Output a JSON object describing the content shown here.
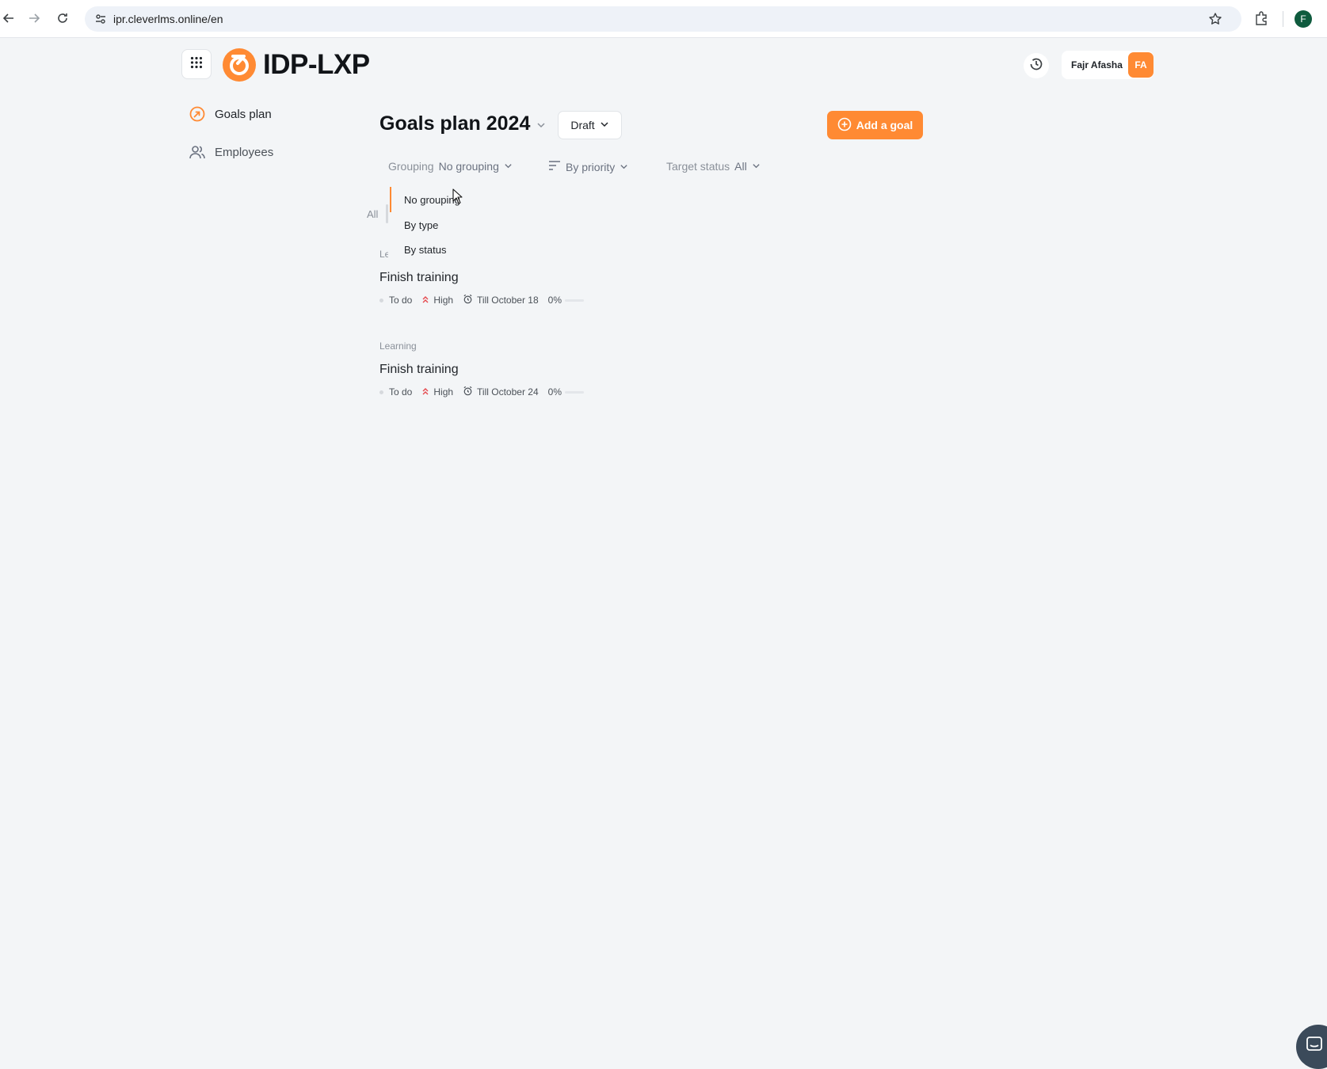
{
  "browser": {
    "url": "ipr.cleverlms.online/en",
    "profile_initial": "F"
  },
  "app": {
    "brand": "IDP-LXP",
    "accent": "#ff8a33",
    "user": {
      "name": "Fajr Afasha",
      "initials": "FA"
    }
  },
  "sidebar": {
    "items": [
      {
        "label": "Goals plan",
        "icon": "target-arrow-icon",
        "active": true
      },
      {
        "label": "Employees",
        "icon": "users-icon",
        "active": false
      }
    ]
  },
  "main": {
    "title": "Goals plan 2024",
    "status_button": "Draft",
    "add_goal_label": "Add a goal",
    "filters": {
      "grouping_label": "Grouping",
      "grouping_value": "No grouping",
      "sort_value": "By priority",
      "target_status_label": "Target status",
      "target_status_value": "All"
    },
    "tabs": {
      "all_label": "All"
    },
    "grouping_dropdown": {
      "options": [
        "No grouping",
        "By type",
        "By status"
      ],
      "selected": "No grouping"
    },
    "goals": [
      {
        "type": "Le",
        "title": "Finish training",
        "status": "To do",
        "priority": "High",
        "deadline": "Till October 18",
        "progress_label": "0%",
        "progress": 0
      },
      {
        "type": "Learning",
        "title": "Finish training",
        "status": "To do",
        "priority": "High",
        "deadline": "Till October 24",
        "progress_label": "0%",
        "progress": 0
      }
    ]
  }
}
